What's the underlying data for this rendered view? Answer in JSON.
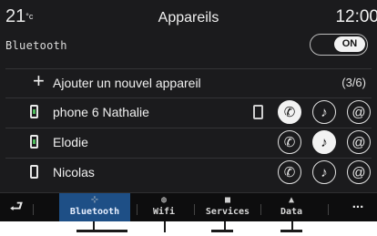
{
  "header": {
    "temperature": "21",
    "temp_unit": "°c",
    "title": "Appareils",
    "clock": "12:00"
  },
  "bluetooth": {
    "label": "Bluetooth",
    "toggle": "ON"
  },
  "add_device": {
    "label": "Ajouter un nouvel appareil",
    "count": "(3/6)"
  },
  "devices": [
    {
      "name": "phone 6 Nathalie",
      "phone": true,
      "call": true,
      "music": false,
      "internet": false
    },
    {
      "name": "Elodie",
      "phone": false,
      "call": false,
      "music": true,
      "internet": false
    },
    {
      "name": "Nicolas",
      "phone": false,
      "call": false,
      "music": false,
      "internet": false
    }
  ],
  "bottom_bar": {
    "back_icon": "back-arrow-icon",
    "tabs": [
      {
        "label": "Bluetooth",
        "icon": "bluetooth-icon",
        "active": true
      },
      {
        "label": "Wifi",
        "icon": "wifi-icon",
        "active": false
      },
      {
        "label": "Services",
        "icon": "services-icon",
        "active": false
      },
      {
        "label": "Data",
        "icon": "data-icon",
        "active": false
      }
    ],
    "more_label": "..."
  },
  "colors": {
    "background": "#1b1b1d",
    "active_tab": "#1e4f86",
    "connected_green": "#4cbb5a"
  }
}
